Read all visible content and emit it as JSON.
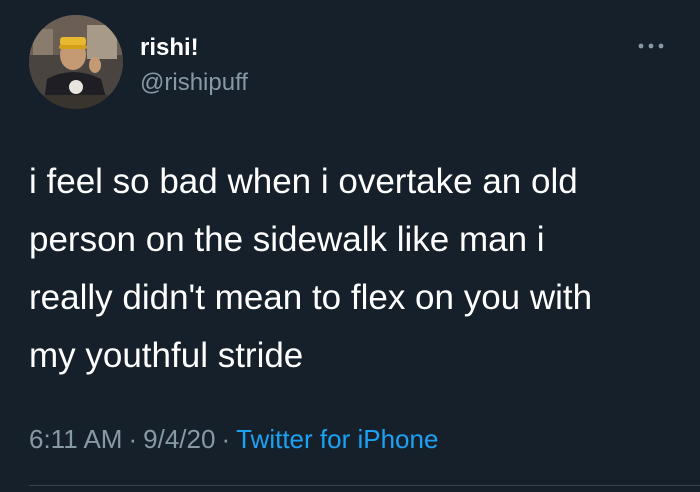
{
  "author": {
    "display_name": "rishi!",
    "handle": "@rishipuff",
    "avatar_icon": "profile-photo"
  },
  "more_icon": "ellipsis-icon",
  "tweet": {
    "text": "i feel so bad when i overtake an old\nperson on the sidewalk like man i\nreally didn't mean to flex on you with\nmy youthful stride"
  },
  "meta": {
    "time": "6:11 AM",
    "separator": "·",
    "date": "9/4/20",
    "source": "Twitter for iPhone"
  },
  "colors": {
    "background": "#15202b",
    "primary_text": "#ffffff",
    "secondary_text": "#8899a6",
    "link": "#1da1f2"
  }
}
